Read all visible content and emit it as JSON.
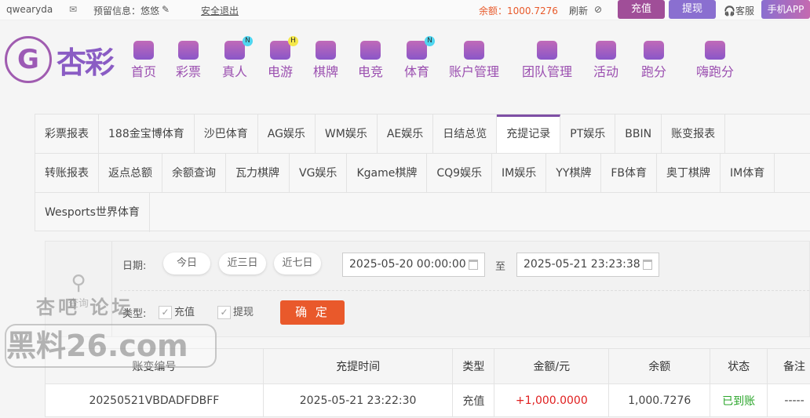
{
  "topbar": {
    "username": "qwearyda",
    "reserved_info": "预留信息：悠悠",
    "logout": "安全退出",
    "balance": "余额：1000.7276",
    "refresh": "刷新",
    "deposit": "充值",
    "withdraw": "提现",
    "service": "客服",
    "mobile_app": "手机APP",
    "colors": {
      "deposit": "#a04e98",
      "withdraw": "#8a6fd0",
      "balance": "#e85a2b"
    }
  },
  "logo": {
    "text": "杏彩"
  },
  "nav": [
    {
      "label": "首页",
      "icon": "home-icon"
    },
    {
      "label": "彩票",
      "icon": "lottery-icon"
    },
    {
      "label": "真人",
      "icon": "live-dealer-icon",
      "badge": "N"
    },
    {
      "label": "电游",
      "icon": "gamepad-icon",
      "badge": "H"
    },
    {
      "label": "棋牌",
      "icon": "cards-icon"
    },
    {
      "label": "电竞",
      "icon": "esports-icon"
    },
    {
      "label": "体育",
      "icon": "trophy-icon",
      "badge": "N"
    },
    {
      "label": "账户管理",
      "icon": "yen-icon"
    },
    {
      "label": "团队管理",
      "icon": "team-icon"
    },
    {
      "label": "活动",
      "icon": "gift-icon"
    },
    {
      "label": "跑分",
      "icon": "rhino-icon"
    },
    {
      "label": "嗨跑分",
      "icon": "hi-icon"
    }
  ],
  "tabs": [
    [
      "彩票报表",
      "188金宝博体育",
      "沙巴体育",
      "AG娱乐",
      "WM娱乐",
      "AE娱乐",
      "日结总览",
      "充提记录",
      "PT娱乐",
      "BBIN",
      "账变报表"
    ],
    [
      "转账报表",
      "返点总额",
      "余额查询",
      "瓦力棋牌",
      "VG娱乐",
      "Kgame棋牌",
      "CQ9娱乐",
      "IM娱乐",
      "YY棋牌",
      "FB体育",
      "奥丁棋牌",
      "IM体育"
    ],
    [
      "Wesports世界体育"
    ]
  ],
  "active_tab": "充提记录",
  "filter": {
    "query": "查询",
    "date_label": "日期:",
    "today": "今日",
    "three_days": "近三日",
    "seven_days": "近七日",
    "start": "2025-05-20 00:00:00",
    "to": "至",
    "end": "2025-05-21 23:23:38",
    "type_label": "类型:",
    "deposit": "充值",
    "withdraw": "提现",
    "confirm": "确 定"
  },
  "table": {
    "headers": [
      "账变编号",
      "充提时间",
      "类型",
      "金额/元",
      "余额",
      "状态",
      "备注"
    ],
    "rows": [
      [
        "20250521VBDADFDBFF",
        "2025-05-21 23:22:30",
        "充值",
        "+1,000.0000",
        "1,000.7276",
        "已到账",
        "-----"
      ]
    ]
  },
  "watermark": {
    "line1": "杏吧 论坛",
    "line2": "黑料26.com"
  }
}
